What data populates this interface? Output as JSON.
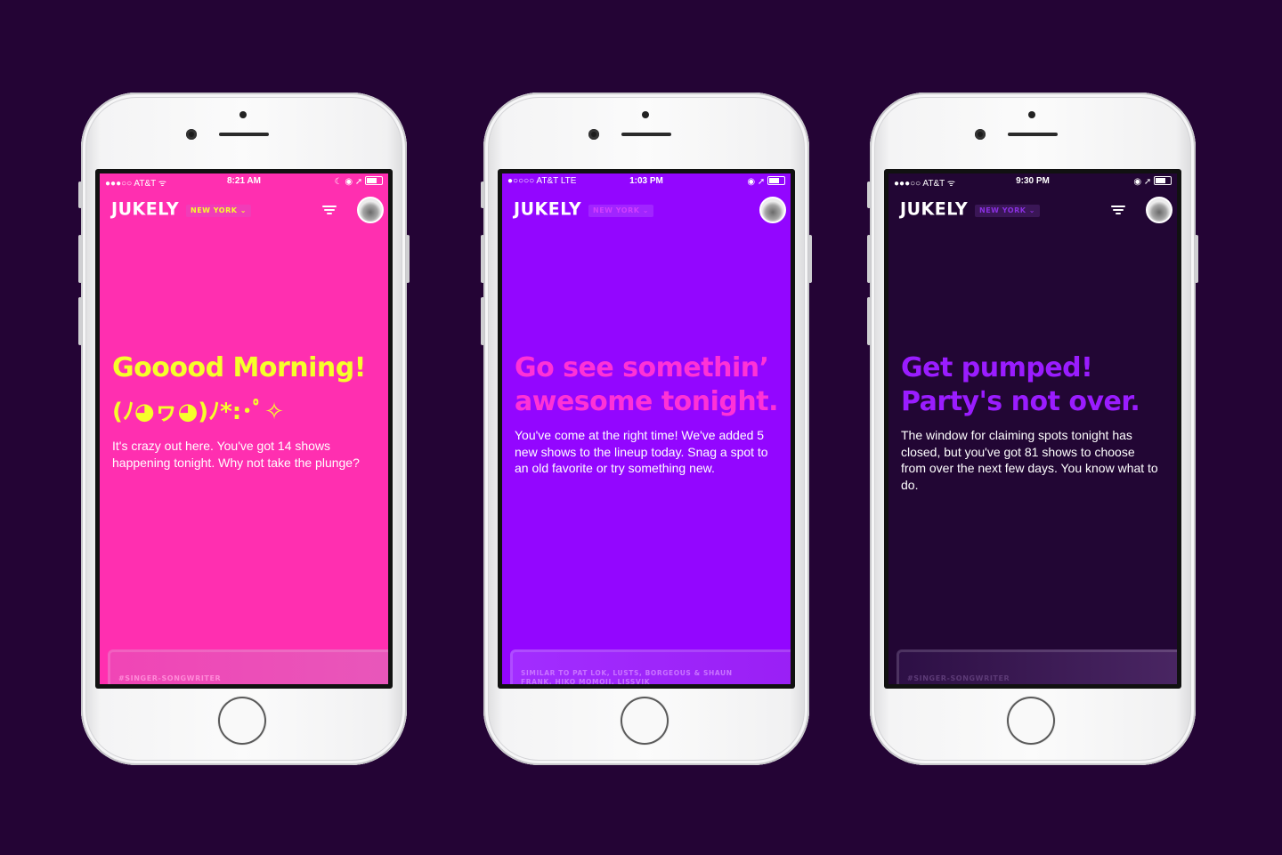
{
  "phones": [
    {
      "status": {
        "carrier": "●●●○○ AT&T ᯤ",
        "time": "8:21 AM",
        "icons": "☾ ◉ ➚"
      },
      "app": {
        "logo": "JUKELY",
        "city": "NEW YORK ⌄"
      },
      "headline": "Gooood Morning!",
      "kaomoji": "(ﾉ◕ヮ◕)ﾉ*:･ﾟ✧",
      "body": "It's crazy out here. You've got 14 shows happening tonight. Why not take the plunge?",
      "card_label": "#SINGER-SONGWRITER"
    },
    {
      "status": {
        "carrier": "●○○○○ AT&T  LTE",
        "time": "1:03 PM",
        "icons": "◉ ➚"
      },
      "app": {
        "logo": "JUKELY",
        "city": "NEW YORK ⌄"
      },
      "headline": "Go see somethin’ awesome tonight.",
      "body": "You've come at the right time! We've added 5 new shows to the lineup today. Snag a spot to an old favorite or try something new.",
      "card_label": "SIMILAR TO PAT LOK, LUSTS, BORGEOUS & SHAUN FRANK, HIKO MOMOJI, LISSVIK"
    },
    {
      "status": {
        "carrier": "●●●○○ AT&T ᯤ",
        "time": "9:30 PM",
        "icons": "◉ ➚"
      },
      "app": {
        "logo": "JUKELY",
        "city": "NEW YORK ⌄"
      },
      "headline": "Get pumped! Party's not over.",
      "body": "The window for claiming spots tonight has closed, but you've got 81 shows to choose from over the next few days. You know what to do.",
      "card_label": "#SINGER-SONGWRITER"
    }
  ],
  "colors": {
    "background": "#240435",
    "pink": "#ff2fb0",
    "purple": "#9306ff",
    "dark": "#220634",
    "yellow": "#f6ff2a"
  },
  "icons": [
    "wifi-icon",
    "battery-icon",
    "filter-icon",
    "avatar",
    "location-icon"
  ]
}
